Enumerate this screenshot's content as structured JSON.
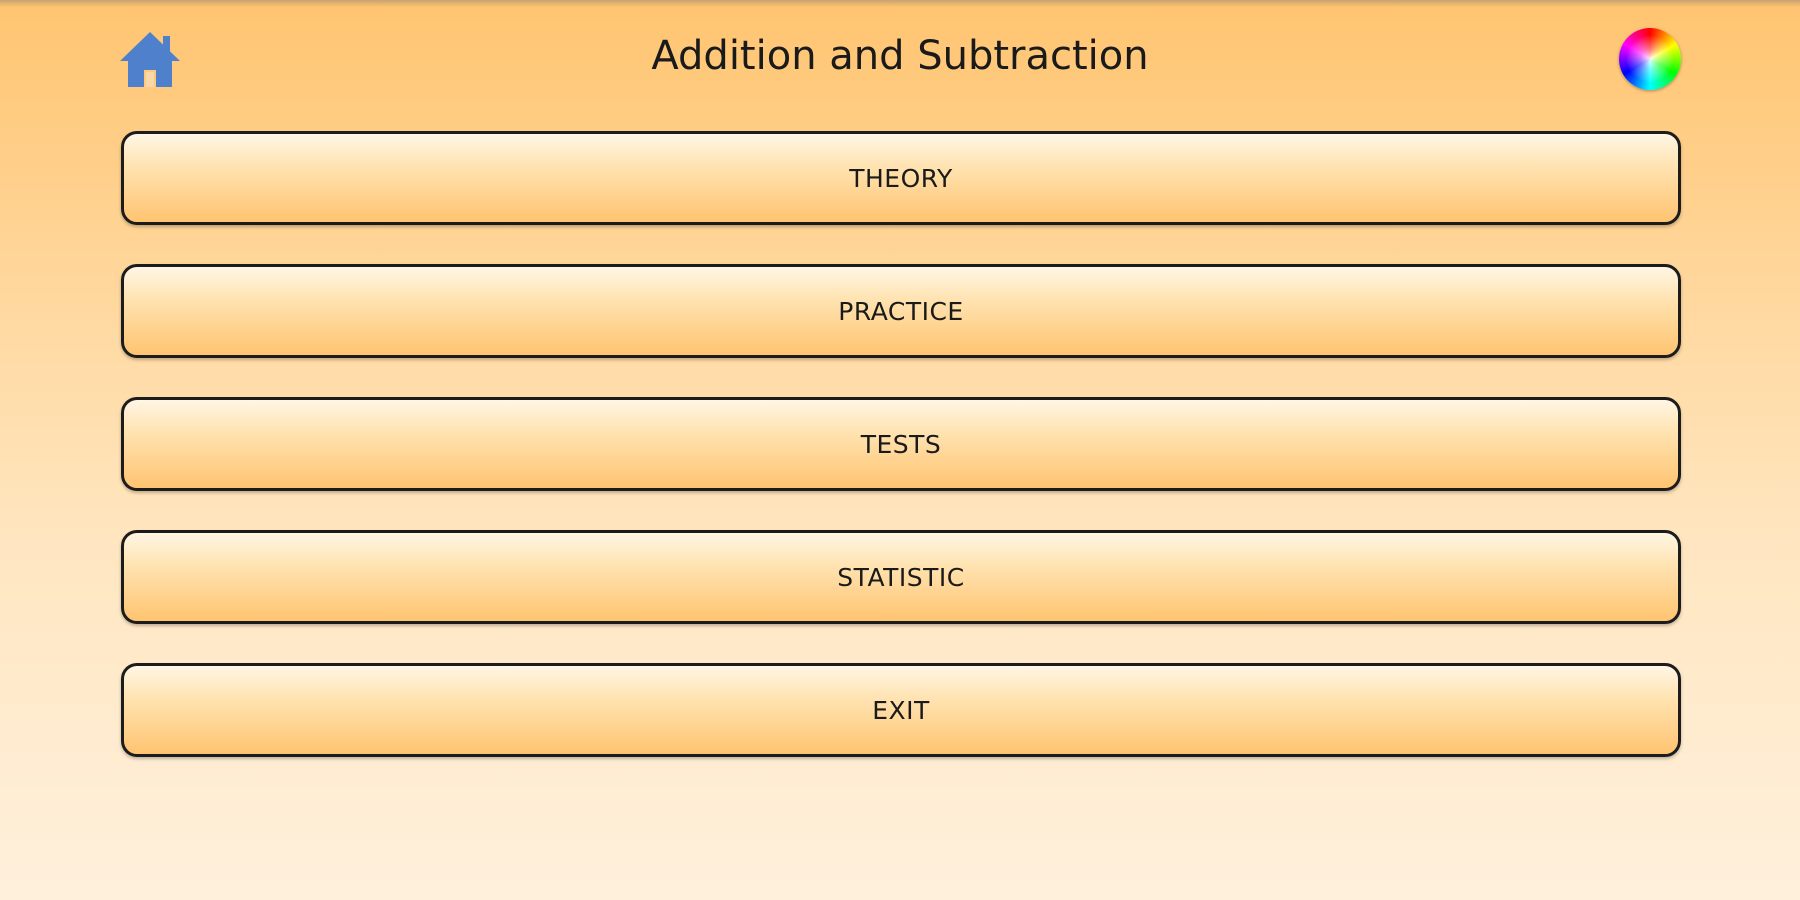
{
  "header": {
    "title": "Addition and Subtraction",
    "home_icon": "home-icon",
    "theme_icon": "color-wheel-icon"
  },
  "menu": {
    "items": [
      {
        "label": "THEORY"
      },
      {
        "label": "PRACTICE"
      },
      {
        "label": "TESTS"
      },
      {
        "label": "STATISTIC"
      },
      {
        "label": "EXIT"
      }
    ]
  },
  "colors": {
    "background_top": "#ffc470",
    "background_bottom": "#fff0dc",
    "button_fill": "#ffd08a",
    "button_border": "#1c1c1c",
    "home_icon": "#4f80cc",
    "text": "#1a1a1a"
  }
}
